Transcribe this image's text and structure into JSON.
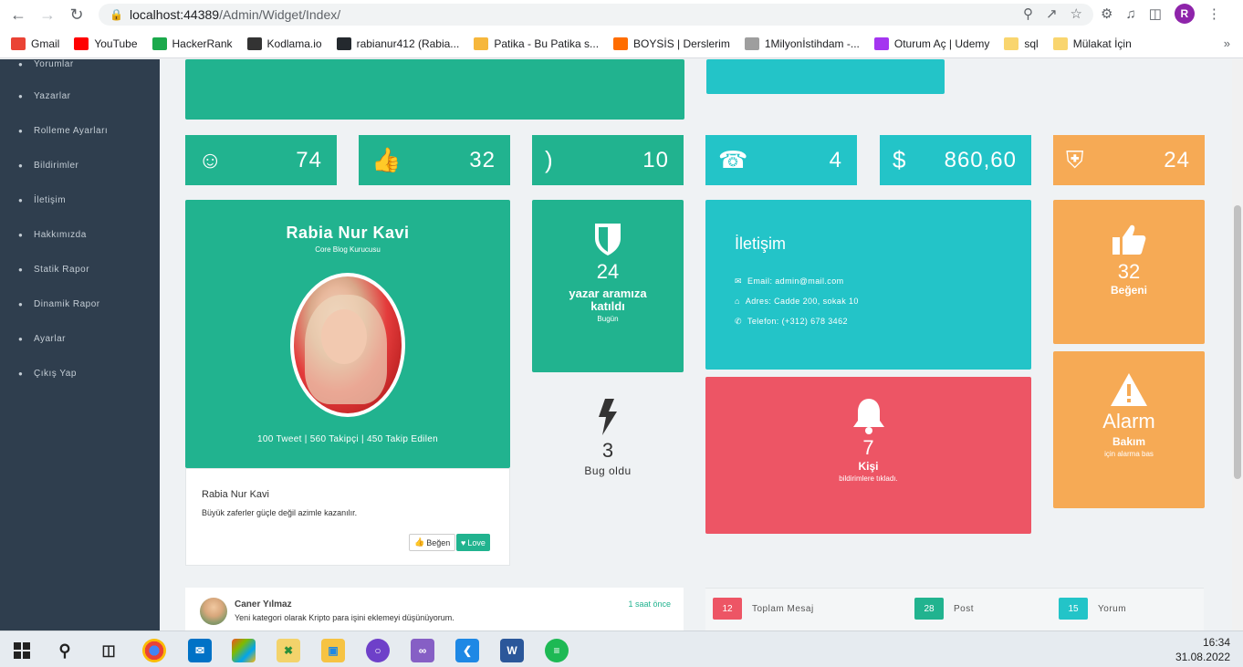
{
  "browser": {
    "url_host": "localhost:44389",
    "url_path": "/Admin/Widget/Index/",
    "profile_initial": "R",
    "bookmarks": [
      {
        "label": "Gmail",
        "icon": "gmail-icon",
        "color": "#ea4335"
      },
      {
        "label": "YouTube",
        "icon": "youtube-icon",
        "color": "#ff0000"
      },
      {
        "label": "HackerRank",
        "icon": "hackerrank-icon",
        "color": "#1ba94c"
      },
      {
        "label": "Kodlama.io",
        "icon": "kodlama-icon",
        "color": "#333333"
      },
      {
        "label": "rabianur412 (Rabia...",
        "icon": "github-icon",
        "color": "#24292e"
      },
      {
        "label": "Patika - Bu Patika s...",
        "icon": "patika-icon",
        "color": "#f6b73c"
      },
      {
        "label": "BOYSİS | Derslerim",
        "icon": "boysis-icon",
        "color": "#ff6d00"
      },
      {
        "label": "1Milyonİstihdam -...",
        "icon": "milyon-icon",
        "color": "#9e9e9e"
      },
      {
        "label": "Oturum Aç | Udemy",
        "icon": "udemy-icon",
        "color": "#a435f0"
      },
      {
        "label": "sql",
        "icon": "folder-icon",
        "color": "#f9d56e"
      },
      {
        "label": "Mülakat İçin",
        "icon": "folder-icon",
        "color": "#f9d56e"
      }
    ]
  },
  "sidebar": {
    "items": [
      {
        "label": "Yorumlar",
        "icon": "comment-icon"
      },
      {
        "label": "Yazarlar",
        "icon": "user-icon"
      },
      {
        "label": "Rolleme Ayarları",
        "icon": "lock-icon"
      },
      {
        "label": "Bildirimler",
        "icon": "bell-icon"
      },
      {
        "label": "İletişim",
        "icon": "phone-icon"
      },
      {
        "label": "Hakkımızda",
        "icon": "edit-icon"
      },
      {
        "label": "Statik Rapor",
        "icon": "pencil-icon"
      },
      {
        "label": "Dinamik Rapor",
        "icon": "edit-icon"
      },
      {
        "label": "Ayarlar",
        "icon": "gear-icon"
      },
      {
        "label": "Çıkış Yap",
        "icon": "apple-icon"
      }
    ]
  },
  "stats": [
    {
      "value": "74",
      "icon": "user-icon",
      "color": "#21b38f"
    },
    {
      "value": "32",
      "icon": "thumbs-up-icon",
      "color": "#21b38f"
    },
    {
      "value": "10",
      "icon": "rss-icon",
      "color": "#21b38f"
    },
    {
      "value": "4",
      "icon": "phone-icon",
      "color": "#23c4c8"
    },
    {
      "value": "860,60",
      "icon": "dollar-icon",
      "color": "#23c4c8"
    },
    {
      "value": "24",
      "icon": "shield-icon",
      "color": "#f6aa55"
    }
  ],
  "profile": {
    "name": "Rabia Nur Kavi",
    "role": "Core Blog Kurucusu",
    "social": "100 Tweet | 560 Takipçi | 450 Takip Edilen",
    "footer_name": "Rabia Nur Kavi",
    "quote": "Büyük zaferler güçle değil azimle kazanılır.",
    "like_label": "Beğen",
    "love_label": "Love"
  },
  "writers_widget": {
    "value": "24",
    "title": "yazar aramıza katıldı",
    "sub": "Bugün"
  },
  "bug_widget": {
    "value": "3",
    "title": "Bug oldu"
  },
  "contact": {
    "title": "İletişim",
    "email": "Email: admin@mail.com",
    "address": "Adres: Cadde 200, sokak 10",
    "phone": "Telefon: (+312) 678 3462"
  },
  "likes_widget": {
    "value": "32",
    "title": "Beğeni"
  },
  "notify_widget": {
    "value": "7",
    "title": "Kişi",
    "sub": "bildirimlere tıkladı."
  },
  "alarm_widget": {
    "title": "Alarm",
    "sub_title": "Bakım",
    "sub": "için alarma bas"
  },
  "message": {
    "author": "Caner Yılmaz",
    "time": "1 saat önce",
    "text": "Yeni kategori olarak Kripto para işini eklemeyi düşünüyorum."
  },
  "summary": [
    {
      "count": "12",
      "label": "Toplam Mesaj",
      "color": "#ed5565"
    },
    {
      "count": "28",
      "label": "Post",
      "color": "#21b38f"
    },
    {
      "count": "15",
      "label": "Yorum",
      "color": "#23c4c8"
    }
  ],
  "taskbar": {
    "time": "16:34",
    "date": "31.08.2022"
  }
}
